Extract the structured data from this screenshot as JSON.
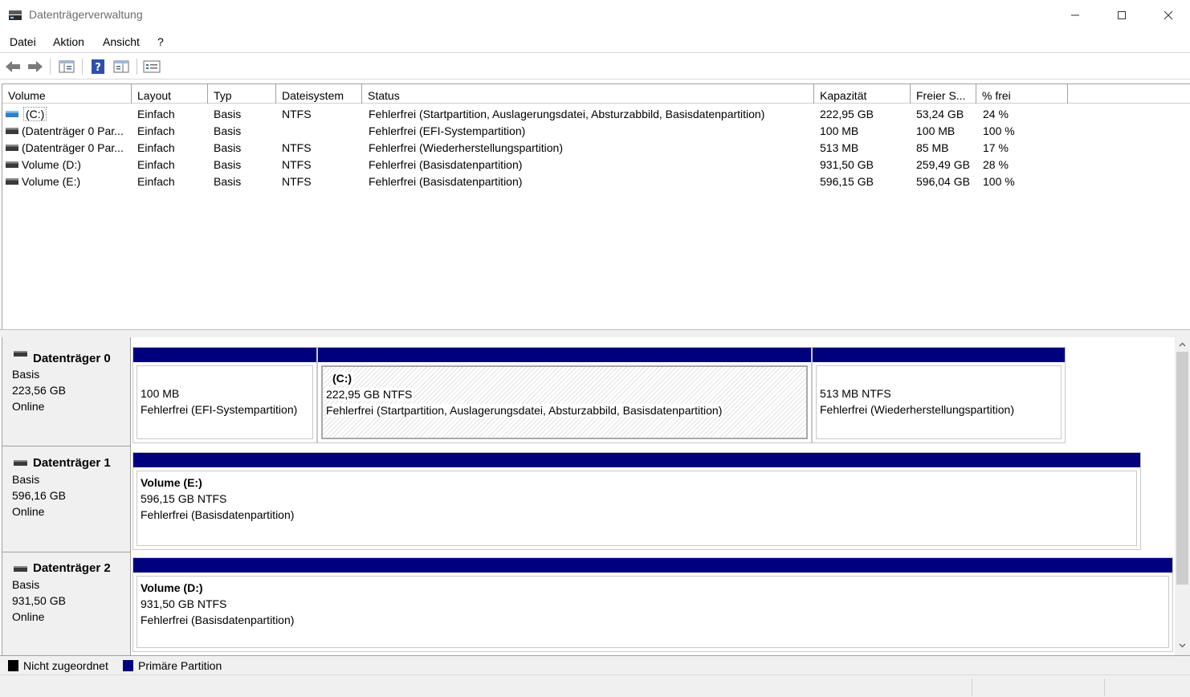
{
  "window": {
    "title": "Datenträgerverwaltung",
    "minimize_icon": "minimize-icon",
    "maximize_icon": "maximize-icon",
    "close_icon": "close-icon"
  },
  "menu": [
    "Datei",
    "Aktion",
    "Ansicht",
    "?"
  ],
  "toolbar": [
    "back-arrow-icon",
    "forward-arrow-icon",
    "console-tree-icon",
    "help-icon",
    "show-pane-icon",
    "properties-icon"
  ],
  "list": {
    "columns": [
      "Volume",
      "Layout",
      "Typ",
      "Dateisystem",
      "Status",
      "Kapazität",
      "Freier S...",
      "% frei"
    ],
    "rows": [
      [
        "(C:)",
        "Einfach",
        "Basis",
        "NTFS",
        "Fehlerfrei (Startpartition, Auslagerungsdatei, Absturzabbild, Basisdatenpartition)",
        "222,95 GB",
        "53,24 GB",
        "24 %"
      ],
      [
        "(Datenträger 0 Par...",
        "Einfach",
        "Basis",
        "",
        "Fehlerfrei (EFI-Systempartition)",
        "100 MB",
        "100 MB",
        "100 %"
      ],
      [
        "(Datenträger 0 Par...",
        "Einfach",
        "Basis",
        "NTFS",
        "Fehlerfrei (Wiederherstellungspartition)",
        "513 MB",
        "85 MB",
        "17 %"
      ],
      [
        "Volume (D:)",
        "Einfach",
        "Basis",
        "NTFS",
        "Fehlerfrei (Basisdatenpartition)",
        "931,50 GB",
        "259,49 GB",
        "28 %"
      ],
      [
        "Volume (E:)",
        "Einfach",
        "Basis",
        "NTFS",
        "Fehlerfrei (Basisdatenpartition)",
        "596,15 GB",
        "596,04 GB",
        "100 %"
      ]
    ]
  },
  "disks": [
    {
      "name": "Datenträger 0",
      "type": "Basis",
      "size": "223,56 GB",
      "state": "Online",
      "partitions": [
        {
          "title": "",
          "line1": "100 MB",
          "line2": "Fehlerfrei (EFI-Systempartition)"
        },
        {
          "title": "(C:)",
          "line1": "222,95 GB NTFS",
          "line2": "Fehlerfrei (Startpartition, Auslagerungsdatei, Absturzabbild, Basisdatenpartition)"
        },
        {
          "title": "",
          "line1": "513 MB NTFS",
          "line2": "Fehlerfrei (Wiederherstellungspartition)"
        }
      ]
    },
    {
      "name": "Datenträger 1",
      "type": "Basis",
      "size": "596,16 GB",
      "state": "Online",
      "partitions": [
        {
          "title": "Volume  (E:)",
          "line1": "596,15 GB NTFS",
          "line2": "Fehlerfrei (Basisdatenpartition)"
        }
      ]
    },
    {
      "name": "Datenträger 2",
      "type": "Basis",
      "size": "931,50 GB",
      "state": "Online",
      "partitions": [
        {
          "title": "Volume  (D:)",
          "line1": "931,50 GB NTFS",
          "line2": "Fehlerfrei (Basisdatenpartition)"
        }
      ]
    }
  ],
  "legend": {
    "unallocated": "Nicht zugeordnet",
    "primary": "Primäre Partition",
    "unallocated_color": "#000000",
    "primary_color": "#00007f"
  }
}
